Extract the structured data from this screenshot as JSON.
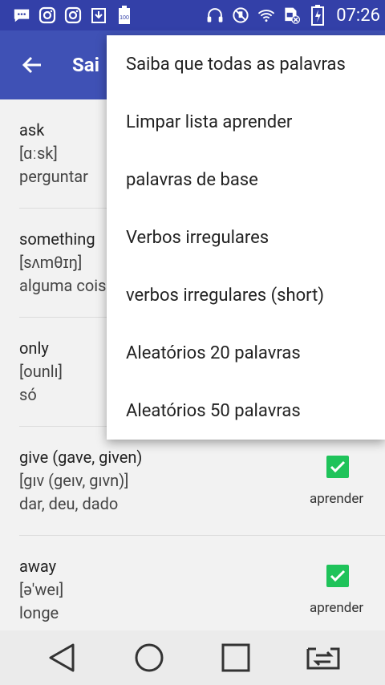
{
  "status_bar": {
    "time": "07:26",
    "left_icons": [
      "message-icon",
      "instagram-icon",
      "instagram-icon",
      "download-icon",
      "battery-100-icon"
    ],
    "right_icons": [
      "headphones-icon",
      "mute-icon",
      "wifi-icon",
      "no-sim-icon",
      "battery-charging-icon"
    ]
  },
  "toolbar": {
    "title": "Sai"
  },
  "words": [
    {
      "word": "ask",
      "ipa": "[ɑːsk]",
      "translation": "perguntar",
      "checked": false
    },
    {
      "word": "something",
      "ipa": "[sʌmθɪŋ]",
      "translation": "alguma coisa",
      "checked": false
    },
    {
      "word": "only",
      "ipa": "[ounlı]",
      "translation": "só",
      "checked": false
    },
    {
      "word": "give (gave, given)",
      "ipa": "[gıv (geıv, gıvn)]",
      "translation": "dar, deu, dado",
      "checked": true,
      "label": "aprender"
    },
    {
      "word": "away",
      "ipa": "[ə'weı]",
      "translation": "longe",
      "checked": true,
      "label": "aprender"
    }
  ],
  "menu": {
    "items": [
      "Saiba que todas as palavras",
      "Limpar lista aprender",
      "palavras de base",
      "Verbos irregulares",
      "verbos irregulares (short)",
      "Aleatórios 20 palavras",
      "Aleatórios 50 palavras"
    ]
  },
  "colors": {
    "status_bar": "#3340a8",
    "toolbar": "#3f51b5",
    "check": "#1fc35a"
  }
}
